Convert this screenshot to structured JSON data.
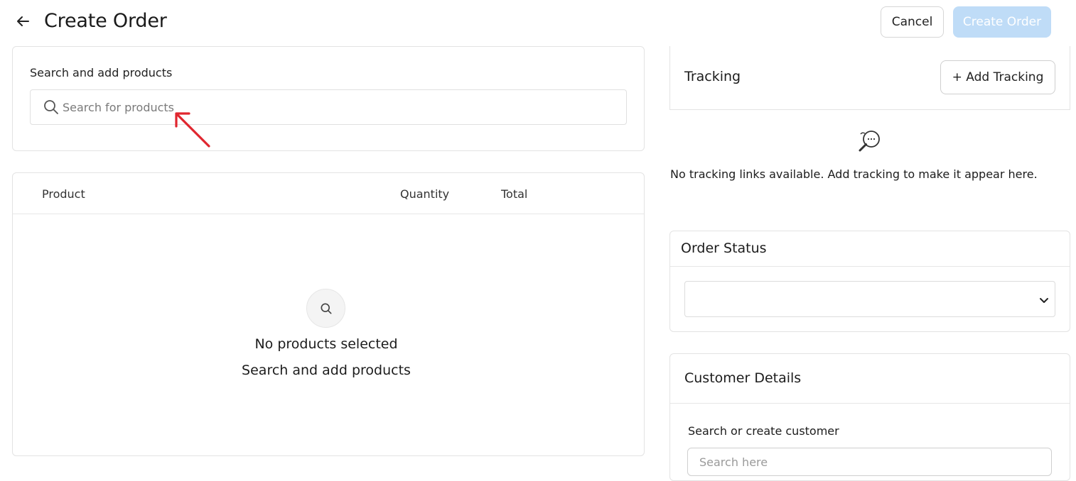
{
  "header": {
    "title": "Create Order",
    "cancel_label": "Cancel",
    "create_label": "Create Order"
  },
  "search": {
    "label": "Search and add products",
    "placeholder": "Search for products"
  },
  "products_table": {
    "columns": [
      "Product",
      "Quantity",
      "Total"
    ],
    "empty_title": "No products selected",
    "empty_subtitle": "Search and add products"
  },
  "tracking": {
    "title": "Tracking",
    "add_label": "+ Add Tracking",
    "empty_text": "No tracking links available. Add tracking to make it appear here."
  },
  "order_status": {
    "title": "Order Status",
    "selected_value": ""
  },
  "customer": {
    "title": "Customer Details",
    "search_label": "Search or create customer",
    "placeholder": "Search here"
  },
  "colors": {
    "accent_disabled": "#bfdcf7",
    "annotation_arrow": "#e0262f"
  }
}
